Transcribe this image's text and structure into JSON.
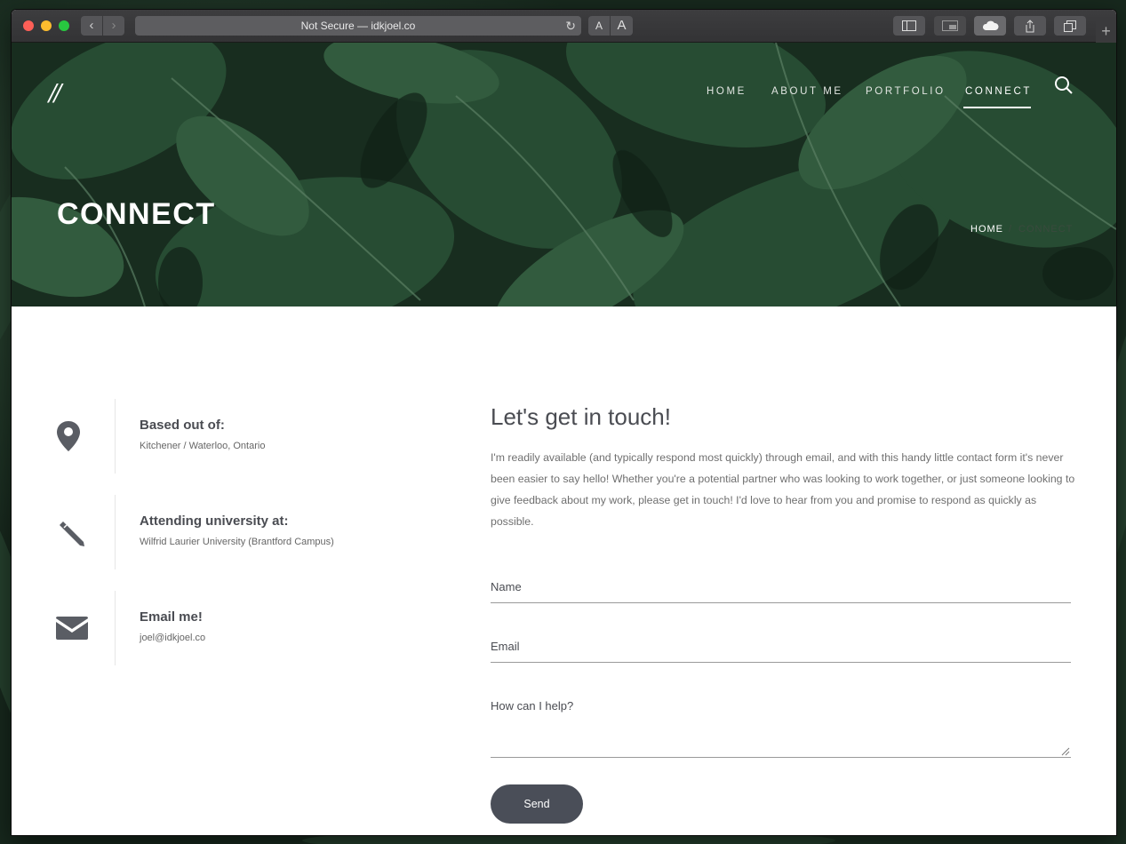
{
  "browser": {
    "url": "Not Secure — idkjoel.co",
    "text_size_small": "A",
    "text_size_large": "A"
  },
  "site": {
    "logo": "//",
    "nav": [
      "HOME",
      "ABOUT ME",
      "PORTFOLIO",
      "CONNECT"
    ],
    "active_nav": "CONNECT"
  },
  "hero": {
    "title": "CONNECT",
    "breadcrumb": [
      "HOME",
      "/",
      "CONNECT"
    ]
  },
  "info": [
    {
      "icon": "map-pin-icon",
      "title": "Based out of:",
      "detail": "Kitchener / Waterloo, Ontario"
    },
    {
      "icon": "pencil-icon",
      "title": "Attending university at:",
      "detail": "Wilfrid Laurier University (Brantford Campus)"
    },
    {
      "icon": "envelope-icon",
      "title": "Email me!",
      "detail": "joel@idkjoel.co"
    }
  ],
  "contact": {
    "heading": "Let's get in touch!",
    "intro": "I'm readily available (and typically respond most quickly) through email, and with this handy little contact form it's never been easier to say hello! Whether you're a potential partner who was looking to work together, or just someone looking to give feedback about my work, please get in touch! I'd love to hear from you and promise to respond as quickly as possible.",
    "fields": [
      "Name",
      "Email",
      "How can I help?"
    ],
    "send_label": "Send"
  },
  "colors": {
    "accent_button": "#4a4e58",
    "heading_text": "#4a4c52",
    "hero_green": "#1f3a28"
  }
}
